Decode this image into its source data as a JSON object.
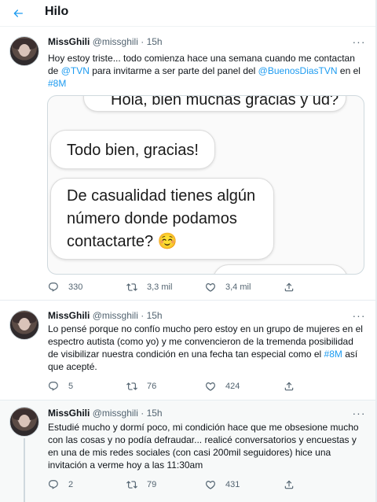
{
  "header": {
    "title": "Hilo"
  },
  "tweets": [
    {
      "name": "MissGhili",
      "handle": "@missghili",
      "dot": "·",
      "time": "15h",
      "text": {
        "p1": "Hoy estoy triste... todo comienza hace una semana cuando me contactan de ",
        "l1": "@TVN",
        "p2": " para invitarme a ser parte del panel del ",
        "l2": "@BuenosDiasTVN",
        "p3": " en el ",
        "l3": "#8M"
      },
      "media": {
        "bubble1": "Hola, bien muchas gracias y ud?",
        "bubble2": "Todo bien, gracias!",
        "bubble3_l1": "De casualidad tienes algún",
        "bubble3_l2": "número donde podamos",
        "bubble3_l3": "contactarte? ☺️"
      },
      "replies": "330",
      "retweets": "3,3 mil",
      "likes": "3,4 mil"
    },
    {
      "name": "MissGhili",
      "handle": "@missghili",
      "dot": "·",
      "time": "15h",
      "text": {
        "p1": "Lo pensé porque no confío mucho pero estoy en un grupo de mujeres en el espectro autista (como yo) y me convencieron de la tremenda posibilidad de visibilizar nuestra condición en una fecha tan especial como el ",
        "l1": "#8M",
        "p2": " así que acepté."
      },
      "replies": "5",
      "retweets": "76",
      "likes": "424"
    },
    {
      "name": "MissGhili",
      "handle": "@missghili",
      "dot": "·",
      "time": "15h",
      "text": {
        "p1": "Estudié mucho y dormí poco, mi condición hace que me obsesione mucho con las cosas y no podía defraudar... realicé conversatorios y encuestas y en una de mis redes sociales (con casi 200mil seguidores) hice una invitación a verme hoy a las 11:30am"
      },
      "replies": "2",
      "retweets": "79",
      "likes": "431"
    }
  ],
  "colors": {
    "accent": "#1d9bf0",
    "muted": "#536471",
    "text": "#0f1419"
  }
}
